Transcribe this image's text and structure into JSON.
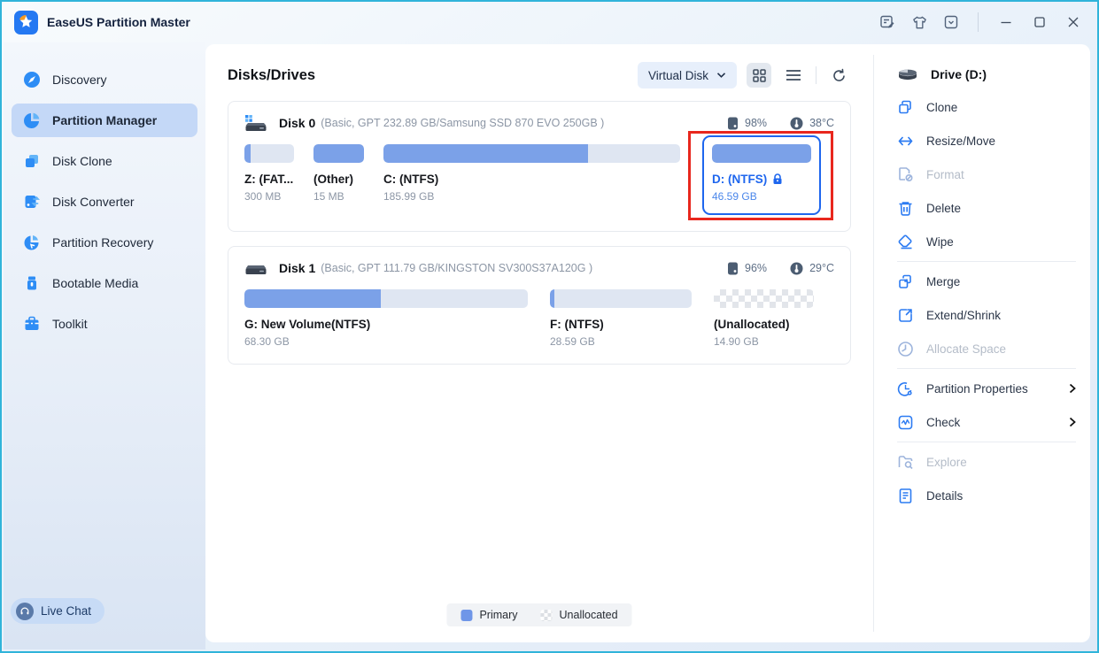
{
  "window": {
    "title": "EaseUS Partition Master"
  },
  "sidebar": {
    "items": [
      {
        "label": "Discovery",
        "icon": "compass-icon",
        "active": false
      },
      {
        "label": "Partition Manager",
        "icon": "pie-chart-icon",
        "active": true
      },
      {
        "label": "Disk Clone",
        "icon": "disk-clone-icon",
        "active": false
      },
      {
        "label": "Disk Converter",
        "icon": "disk-converter-icon",
        "active": false
      },
      {
        "label": "Partition Recovery",
        "icon": "partition-recovery-icon",
        "active": false
      },
      {
        "label": "Bootable Media",
        "icon": "usb-drive-icon",
        "active": false
      },
      {
        "label": "Toolkit",
        "icon": "toolbox-icon",
        "active": false
      }
    ],
    "live_chat_label": "Live Chat"
  },
  "main": {
    "title": "Disks/Drives",
    "disk_filter": {
      "selected": "Virtual Disk"
    },
    "view_icons": [
      "grid-view-icon",
      "list-view-icon",
      "refresh-icon"
    ],
    "disks": [
      {
        "name": "Disk 0",
        "info": "(Basic, GPT 232.89 GB/Samsung SSD 870 EVO 250GB )",
        "health": "98%",
        "temperature": "38°C",
        "partitions": [
          {
            "label": "Z: (FAT...",
            "size": "300 MB",
            "fill_percent": 12
          },
          {
            "label": "(Other)",
            "size": "15 MB",
            "fill_percent": 100
          },
          {
            "label": "C: (NTFS)",
            "size": "185.99 GB",
            "fill_percent": 69
          },
          {
            "label": "D: (NTFS)",
            "size": "46.59 GB",
            "fill_percent": 100,
            "selected": true,
            "locked": true,
            "annotated": true
          }
        ]
      },
      {
        "name": "Disk 1",
        "info": "(Basic, GPT 111.79 GB/KINGSTON SV300S37A120G )",
        "health": "96%",
        "temperature": "29°C",
        "partitions": [
          {
            "label": "G: New Volume(NTFS)",
            "size": "68.30 GB",
            "fill_percent": 48
          },
          {
            "label": "F: (NTFS)",
            "size": "28.59 GB",
            "fill_percent": 3
          },
          {
            "label": "(Unallocated)",
            "size": "14.90 GB",
            "unallocated": true
          }
        ]
      }
    ],
    "legend": [
      {
        "label": "Primary",
        "type": "primary"
      },
      {
        "label": "Unallocated",
        "type": "unallocated"
      }
    ]
  },
  "actions_panel": {
    "title": "Drive (D:)",
    "items": [
      {
        "label": "Clone",
        "disabled": false
      },
      {
        "label": "Resize/Move",
        "disabled": false
      },
      {
        "label": "Format",
        "disabled": true
      },
      {
        "label": "Delete",
        "disabled": false
      },
      {
        "label": "Wipe",
        "disabled": false
      },
      {
        "label": "Merge",
        "disabled": false
      },
      {
        "label": "Extend/Shrink",
        "disabled": false
      },
      {
        "label": "Allocate Space",
        "disabled": true
      },
      {
        "label": "Partition Properties",
        "disabled": false,
        "submenu": true
      },
      {
        "label": "Check",
        "disabled": false,
        "submenu": true
      },
      {
        "label": "Explore",
        "disabled": true
      },
      {
        "label": "Details",
        "disabled": false
      }
    ]
  },
  "colors": {
    "accent_blue": "#2677f0",
    "bar_blue": "#7ba1e8",
    "bar_track": "#dfe6f2",
    "selected_blue": "#1e66ee",
    "annotation_red": "#e8271d",
    "window_border_teal": "#30b4da",
    "sidebar_selected_bg": "#c4d8f7"
  }
}
